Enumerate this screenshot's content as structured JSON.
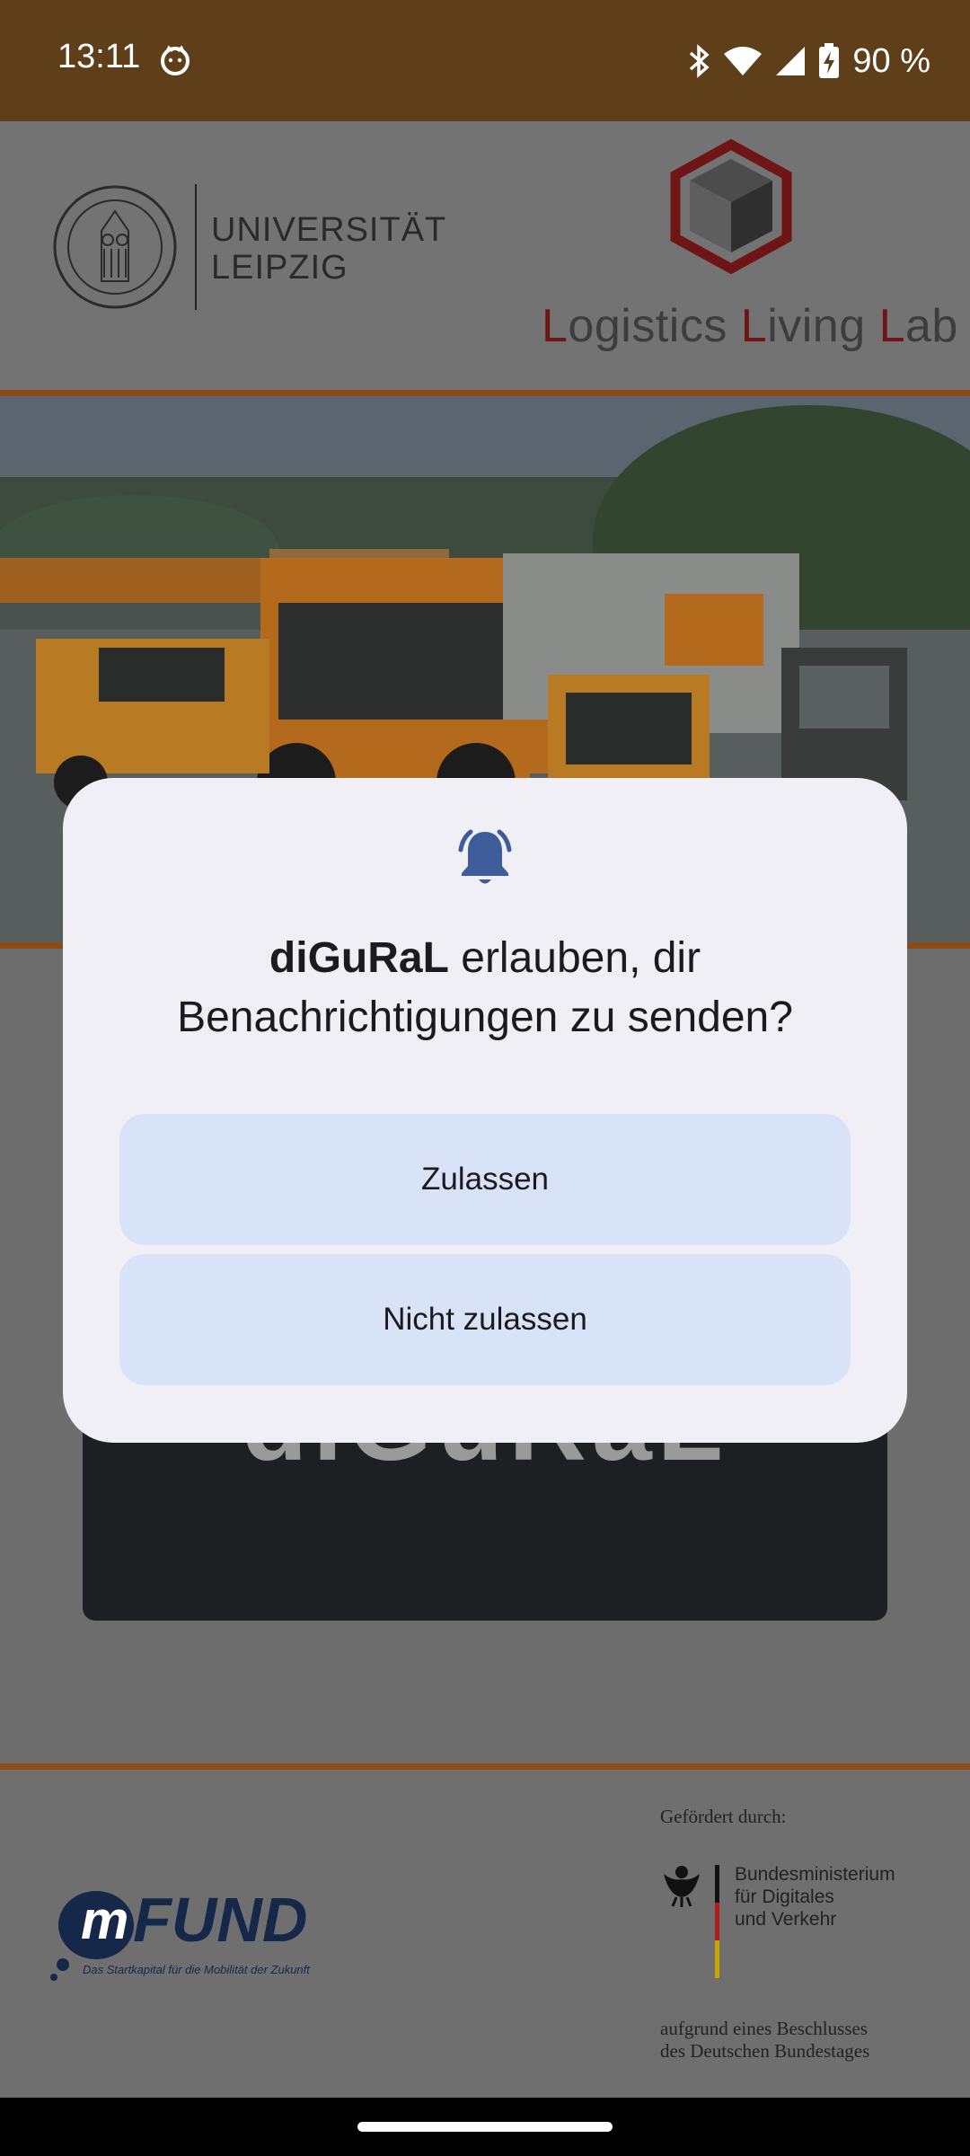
{
  "status_bar": {
    "time": "13:11",
    "battery": "90 %",
    "icons": [
      "cat-face-icon",
      "bluetooth-icon",
      "wifi-icon",
      "signal-icon",
      "battery-charging-icon"
    ]
  },
  "header": {
    "university_line1": "UNIVERSITÄT",
    "university_line2": "LEIPZIG",
    "lab_L1": "L",
    "lab_word1": "ogistics ",
    "lab_L2": "L",
    "lab_word2": "iving ",
    "lab_L3": "L",
    "lab_word3": "ab"
  },
  "dialog": {
    "app_name": "diGuRaL",
    "message": " erlauben, dir Benachrichtigungen zu senden?",
    "allow_label": "Zulassen",
    "deny_label": "Nicht zulassen"
  },
  "card": {
    "logo_text": "diGuRaL"
  },
  "footer": {
    "mfund_m": "m",
    "mfund_word": "FUND",
    "mfund_tagline": "Das Startkapital für die Mobilität der Zukunft",
    "funded_by": "Gefördert durch:",
    "ministry_line1": "Bundesministerium",
    "ministry_line2": "für Digitales",
    "ministry_line3": "und Verkehr",
    "resolution_line1": "aufgrund eines Beschlusses",
    "resolution_line2": "des Deutschen Bundestages"
  },
  "colors": {
    "status_bar": "#5e3f1a",
    "accent_line": "#8c4c18",
    "dialog_bg": "#f0eff6",
    "button_bg": "#d9e3f8",
    "bell": "#3f5c9a"
  }
}
